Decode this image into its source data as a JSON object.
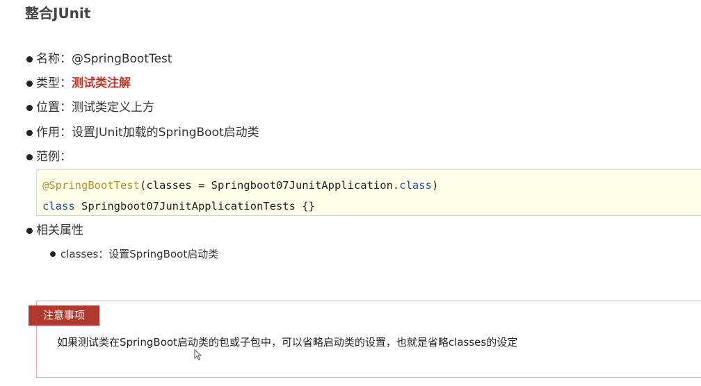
{
  "title": "整合JUnit",
  "bullets": [
    {
      "label": "名称：",
      "value": "@SpringBootTest"
    },
    {
      "label": "类型：",
      "value": "测试类注解"
    },
    {
      "label": "位置：",
      "value": "测试类定义上方"
    },
    {
      "label": "作用：",
      "value": "设置JUnit加载的SpringBoot启动类"
    },
    {
      "label": "范例：",
      "value": ""
    },
    {
      "label": "相关属性",
      "value": ""
    }
  ],
  "code": {
    "line1_annotation": "@SpringBootTest",
    "line1_rest": "(classes = Springboot07JunitApplication.",
    "line1_kw": "class",
    "line1_end": ")",
    "line2_kw": "class",
    "line2_rest": " Springboot07JunitApplicationTests {}"
  },
  "sub_bullets": [
    {
      "label": "classes：",
      "value": "设置SpringBoot启动类"
    }
  ],
  "note": {
    "tag": "注意事项",
    "text": "如果测试类在SpringBoot启动类的包或子包中，可以省略启动类的设置，也就是省略classes的设定"
  },
  "colors": {
    "highlight": "#c0392b",
    "note_tag_bg": "#b03a2e",
    "code_bg": "#fdfde8",
    "annotation": "#b5912f",
    "keyword": "#1f4fa8"
  }
}
